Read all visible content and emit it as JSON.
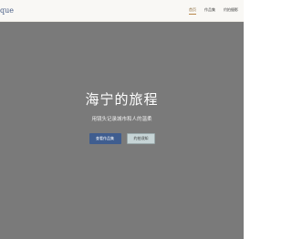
{
  "nav": {
    "brand": "que",
    "links": [
      {
        "label": "首页",
        "active": true
      },
      {
        "label": "作品集",
        "active": false
      },
      {
        "label": "约拍摄影",
        "active": false
      }
    ]
  },
  "hero": {
    "title": "海宁的旅程",
    "subtitle": "用镜头记录城市和人的温柔",
    "primary_button": "查看作品集",
    "secondary_button": "约拍须知"
  },
  "colors": {
    "hero_background": "#7a7a7a",
    "primary_button": "#3f5d8f",
    "secondary_button": "#c6d4d6",
    "active_underline": "#b8864a"
  }
}
